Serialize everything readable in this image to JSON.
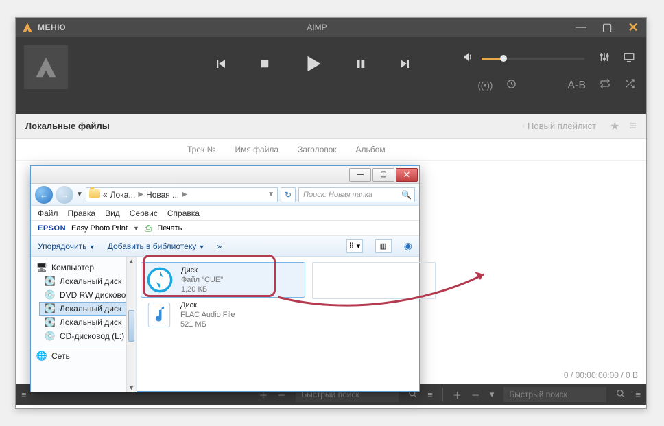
{
  "aimp": {
    "menu_label": "МЕНЮ",
    "title": "AIMP",
    "tabs": {
      "local": "Локальные файлы",
      "new_playlist": "Новый плейлист"
    },
    "headers": {
      "track_no": "Трек №",
      "file_name": "Имя файла",
      "title": "Заголовок",
      "album": "Альбом"
    },
    "status_line": "0 / 00:00:00:00 / 0 B",
    "sub_row": {
      "ab": "A-B"
    },
    "bottom": {
      "search_left_placeholder": "Быстрый поиск",
      "search_right_placeholder": "Быстрый поиск"
    }
  },
  "explorer": {
    "breadcrumb": {
      "prefix": "«",
      "seg1": "Лока...",
      "seg2": "Новая ..."
    },
    "search_placeholder": "Поиск: Новая папка",
    "menu": {
      "file": "Файл",
      "edit": "Правка",
      "view": "Вид",
      "tools": "Сервис",
      "help": "Справка"
    },
    "epson": {
      "brand": "EPSON",
      "epp": "Easy Photo Print",
      "print": "Печать"
    },
    "toolbar": {
      "arrange": "Упорядочить",
      "add_lib": "Добавить в библиотеку",
      "more": "»"
    },
    "tree": {
      "computer": "Компьютер",
      "local_disk_1": "Локальный диск",
      "dvd": "DVD RW дисково",
      "local_disk_sel": "Локальный диск",
      "local_disk_3": "Локальный диск",
      "cd": "CD-дисковод (L:)",
      "network": "Сеть"
    },
    "files": [
      {
        "name": "Диск",
        "type": "Файл \"CUE\"",
        "size": "1,20 КБ",
        "kind": "cue"
      },
      {
        "name": "Диск",
        "type": "FLAC Audio File",
        "size": "521 МБ",
        "kind": "flac"
      }
    ]
  }
}
